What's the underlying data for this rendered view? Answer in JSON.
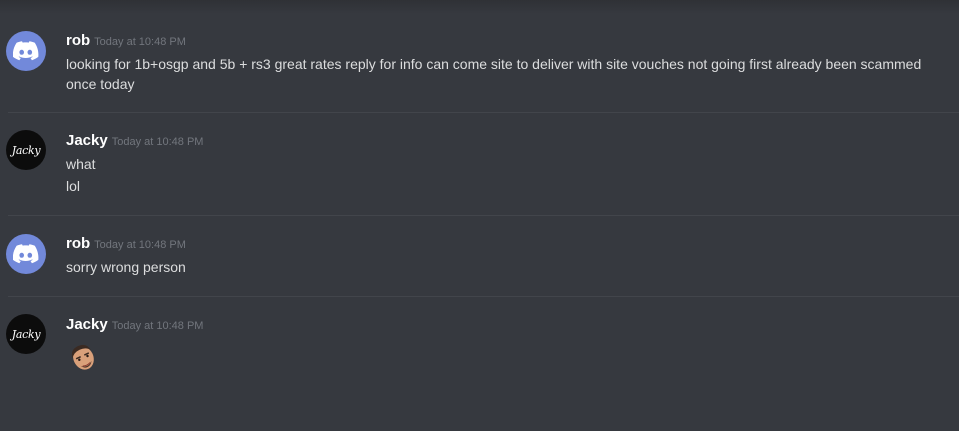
{
  "messages": [
    {
      "author": "rob",
      "avatar": "discord-default-avatar",
      "timestamp": "Today at 10:48 PM",
      "lines": [
        "looking for 1b+osgp and 5b + rs3 great rates reply for info can come site to deliver with site vouches not going first already been scammed",
        "once today"
      ]
    },
    {
      "author": "Jacky",
      "avatar_text": "Jacky",
      "timestamp": "Today at 10:48 PM",
      "lines": [
        "what",
        "lol"
      ]
    },
    {
      "author": "rob",
      "avatar": "discord-default-avatar",
      "timestamp": "Today at 10:48 PM",
      "lines": [
        "sorry wrong person"
      ]
    },
    {
      "author": "Jacky",
      "avatar_text": "Jacky",
      "timestamp": "Today at 10:48 PM",
      "emoji": "face-emoji"
    }
  ],
  "colors": {
    "background": "#36393f",
    "username": "#ffffff",
    "timestamp": "#72767d",
    "message_text": "#dcddde",
    "blurple": "#7289da",
    "divider": "#42454b"
  }
}
